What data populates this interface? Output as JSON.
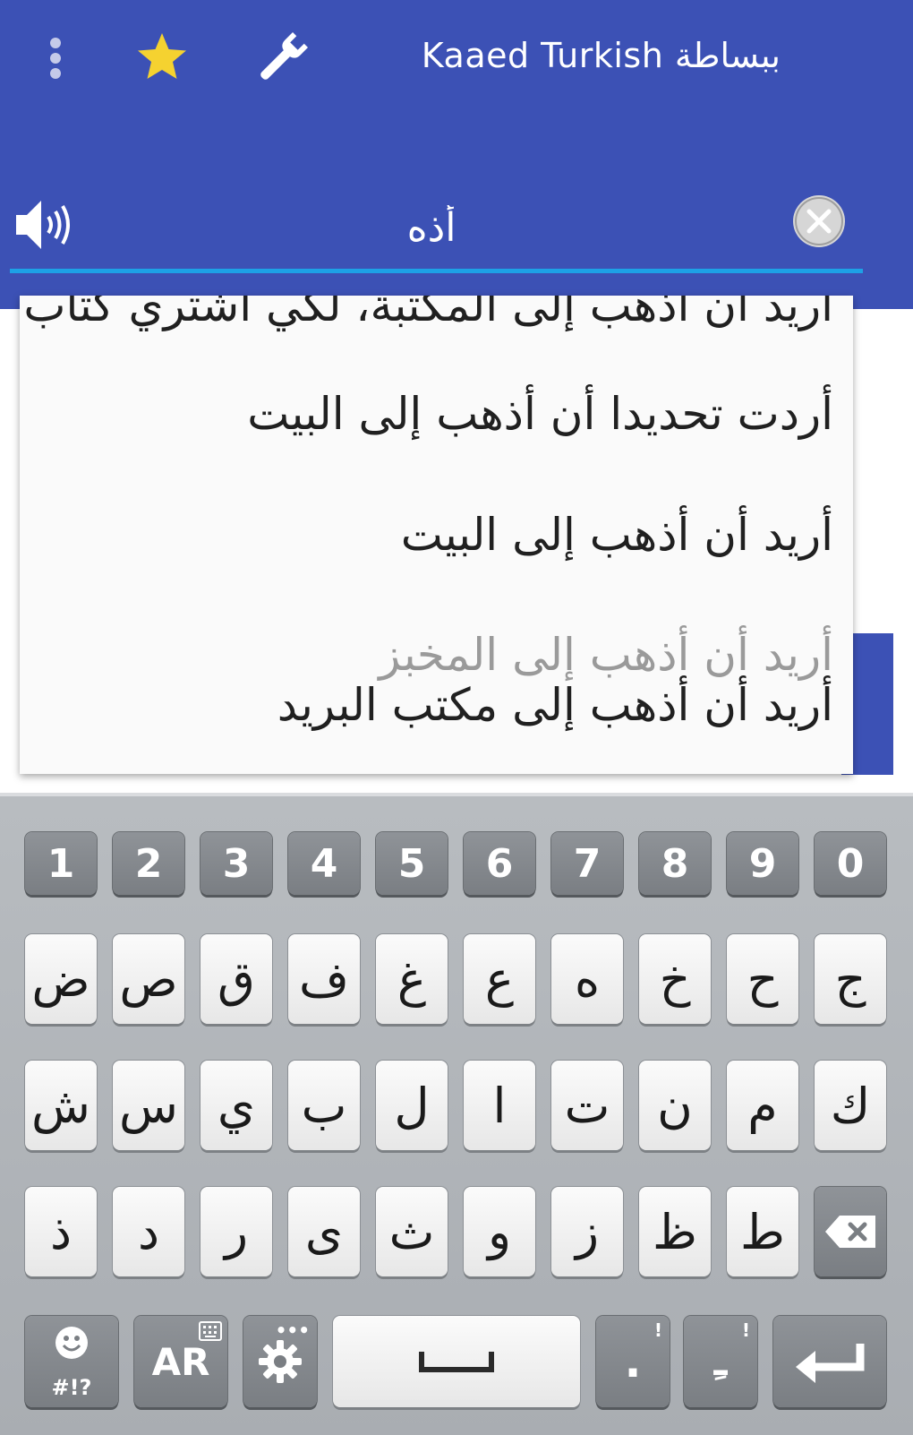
{
  "app": {
    "title": "Kaaed Turkish ببساطة"
  },
  "search": {
    "value": "أذه"
  },
  "suggestions": [
    "أريد أن أذهب إلى المكتبة، لكي أشتري كتاب",
    "أردت تحديدا أن أذهب إلى البيت",
    "أريد أن أذهب إلى البيت",
    "أريد أن أذهب إلى المخبز",
    "أريد أن أذهب إلى مكتب البريد"
  ],
  "keyboard": {
    "numbers": [
      "1",
      "2",
      "3",
      "4",
      "5",
      "6",
      "7",
      "8",
      "9",
      "0"
    ],
    "row1": [
      "ض",
      "ص",
      "ق",
      "ف",
      "غ",
      "ع",
      "ه",
      "خ",
      "ح",
      "ج"
    ],
    "row2": [
      "ش",
      "س",
      "ي",
      "ب",
      "ل",
      "ا",
      "ت",
      "ن",
      "م",
      "ك"
    ],
    "row3": [
      "ذ",
      "د",
      "ر",
      "ى",
      "ث",
      "و",
      "ز",
      "ظ",
      "ط"
    ],
    "symbols_label": "#!?",
    "lang_label": "AR",
    "period_key": ".",
    "period_hint": "!",
    "diacritic_key": "ـِ",
    "diacritic_hint": "!"
  },
  "colors": {
    "primary": "#3c51b5",
    "accent": "#1da1e6",
    "star": "#f5d230"
  }
}
